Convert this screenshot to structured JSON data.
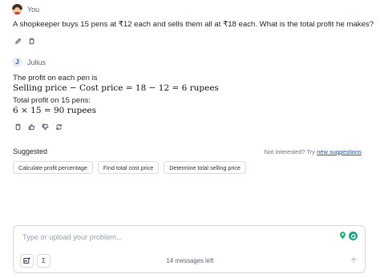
{
  "user_message": {
    "author": "You",
    "text": "A shopkeeper buys 15 pens at ₹12 each and sells them all at ₹18 each. What is the total profit he makes?"
  },
  "assistant_message": {
    "author": "Julius",
    "avatar_letter": "J",
    "line1": "The profit on each pen is",
    "math1": "Selling price − Cost price = 18 − 12 = 6 rupees",
    "line2": "Total profit on 15 pens:",
    "math2": "6 × 15 = 90 rupees"
  },
  "suggested": {
    "title": "Suggested",
    "not_interested_prefix": "Not interested? Try ",
    "new_suggestions_link": "new suggestions",
    "chips": [
      "Calculate profit percentage",
      "Find total cost price",
      "Determine total selling price"
    ]
  },
  "composer": {
    "placeholder": "Type or upload your problem...",
    "messages_left": "14 messages left",
    "sigma_label": "Σ"
  },
  "icons": {
    "user_actions": [
      "edit-icon",
      "copy-icon"
    ],
    "assistant_actions": [
      "copy-icon",
      "thumbs-up-icon",
      "thumbs-down-icon",
      "regenerate-icon"
    ],
    "composer": [
      "image-upload-icon",
      "sigma-icon",
      "send-arrow-icon"
    ]
  },
  "colors": {
    "accent_green": "#14a37f",
    "link_blue": "#1f4f99"
  }
}
